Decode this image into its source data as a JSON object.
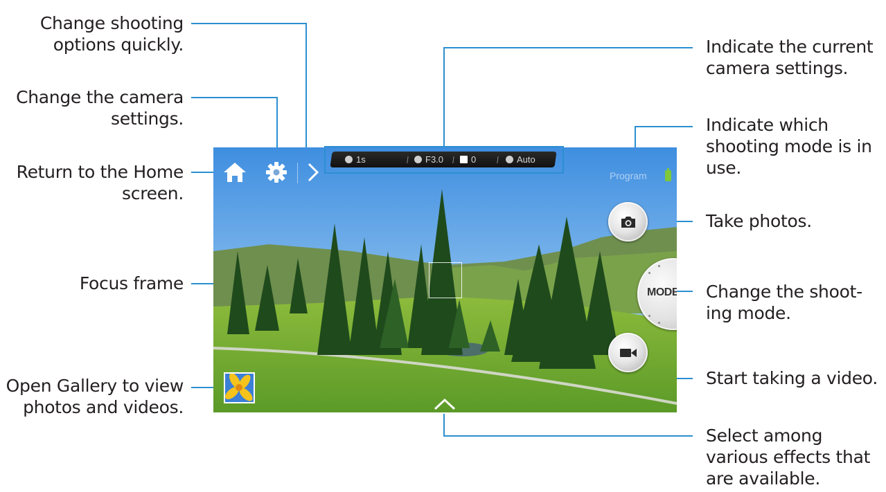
{
  "callouts_left": {
    "options": [
      "Change shooting",
      "options quickly."
    ],
    "settings": [
      "Change the camera",
      "settings."
    ],
    "home": [
      "Return to the Home",
      "screen."
    ],
    "focus": [
      "Focus frame"
    ],
    "gallery": [
      "Open Gallery to view",
      "photos and videos."
    ]
  },
  "callouts_right": {
    "current": [
      "Indicate the current",
      "camera settings."
    ],
    "mode": [
      "Indicate which",
      "shooting mode is in",
      "use."
    ],
    "photo": [
      "Take photos."
    ],
    "shoot_mode": [
      "Change the shoot-",
      "ing mode."
    ],
    "video": [
      "Start taking a video."
    ],
    "effects": [
      "Select among",
      "various effects that",
      "are available."
    ]
  },
  "camera": {
    "status_bar": {
      "shutter": "1s",
      "aperture": "F3.0",
      "exposure": "0",
      "iso": "Auto"
    },
    "shooting_mode": "Program",
    "mode_button_label": "MODE"
  },
  "colors": {
    "leader_line": "#2b8fd0",
    "battery": "#7ec83a"
  },
  "icons": [
    "home-icon",
    "gear-icon",
    "chevron-right-icon",
    "camera-icon",
    "video-camera-icon",
    "chevron-up-icon",
    "battery-icon"
  ]
}
